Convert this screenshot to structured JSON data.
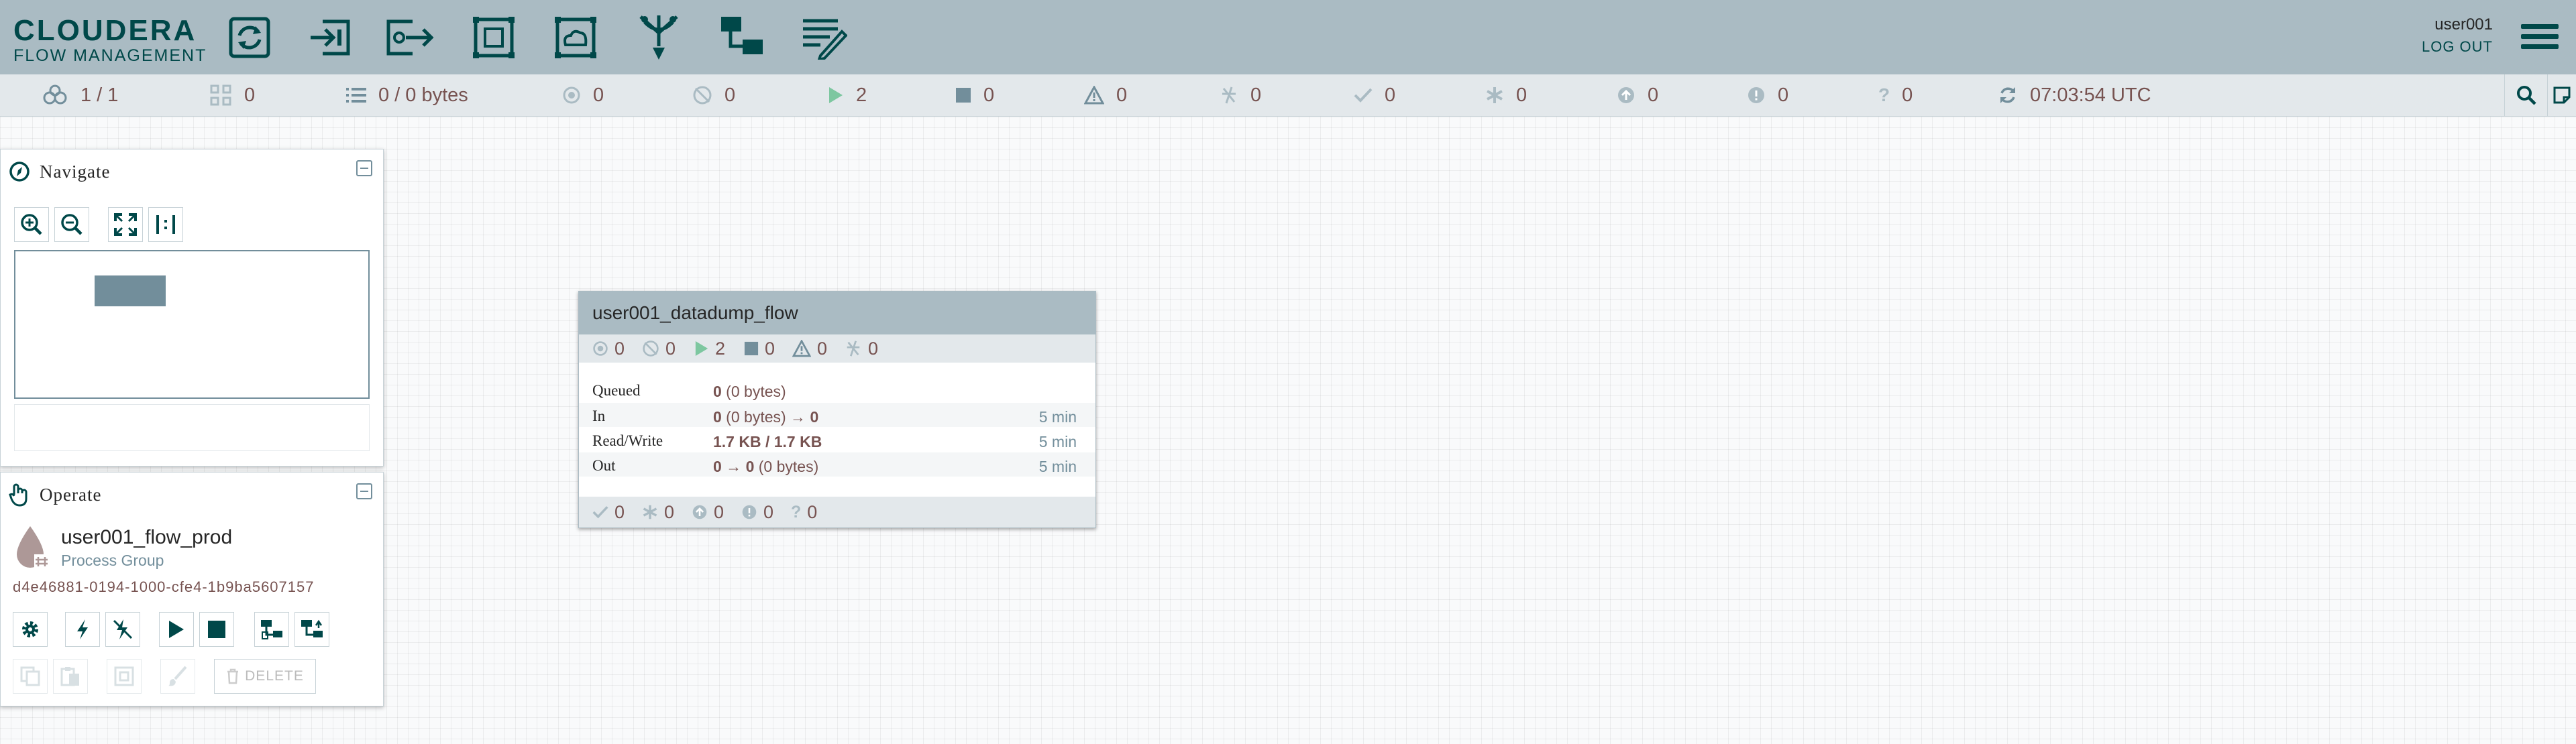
{
  "header": {
    "logo_main": "CLOUDERA",
    "logo_sub": "FLOW MANAGEMENT",
    "tools": [
      {
        "name": "processor-tool"
      },
      {
        "name": "input-port-tool"
      },
      {
        "name": "output-port-tool"
      },
      {
        "name": "process-group-tool"
      },
      {
        "name": "remote-process-group-tool"
      },
      {
        "name": "funnel-tool"
      },
      {
        "name": "template-tool"
      },
      {
        "name": "label-tool"
      }
    ],
    "user": "user001",
    "logout": "LOG OUT"
  },
  "status": {
    "transmitting_clusters": "1 / 1",
    "cluster_nodes": "0",
    "queued": "0 / 0 bytes",
    "transmitting": "0",
    "not_transmitting": "0",
    "running": "2",
    "stopped": "0",
    "invalid": "0",
    "disabled": "0",
    "up_to_date": "0",
    "locally_modified": "0",
    "stale": "0",
    "sync_failure": "0",
    "unknown": "0",
    "refresh_time": "07:03:54 UTC"
  },
  "navigate": {
    "title": "Navigate"
  },
  "operate": {
    "title": "Operate",
    "name": "user001_flow_prod",
    "type": "Process Group",
    "id": "d4e46881-0194-1000-cfe4-1b9ba5607157",
    "delete_label": "DELETE"
  },
  "process_group": {
    "name": "user001_datadump_flow",
    "stats": {
      "transmitting": "0",
      "not_transmitting": "0",
      "running": "2",
      "stopped": "0",
      "invalid": "0",
      "disabled": "0"
    },
    "rows": [
      {
        "label": "Queued",
        "value_bold": "0",
        "value_rest": " (0 bytes)",
        "time": ""
      },
      {
        "label": "In",
        "value_bold": "0",
        "value_rest": " (0 bytes) → ",
        "value_bold2": "0",
        "time": "5 min"
      },
      {
        "label": "Read/Write",
        "value_bold": "1.7 KB / 1.7 KB",
        "value_rest": "",
        "time": "5 min"
      },
      {
        "label": "Out",
        "value_bold": "0 → 0",
        "value_rest": " (0 bytes)",
        "time": "5 min"
      }
    ],
    "footer": {
      "up_to_date": "0",
      "locally_modified": "0",
      "stale": "0",
      "sync_failure": "0",
      "unknown": "0"
    }
  },
  "colors": {
    "header_bg": "#aabbc3",
    "statusbar_bg": "#e3e8eb",
    "brand_teal": "#004849",
    "value_text": "#775351",
    "running_green": "#7dc7a0",
    "muted": "#728e9b"
  }
}
